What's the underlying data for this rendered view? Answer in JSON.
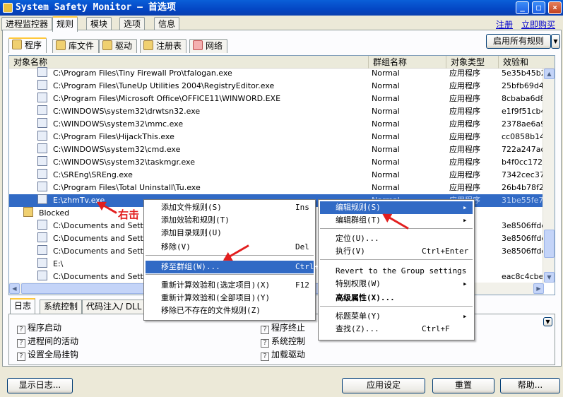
{
  "window": {
    "title": "System Safety Monitor — 首选项",
    "min": "_",
    "max": "□",
    "close": "×"
  },
  "top_tabs": [
    "进程监控器",
    "规则",
    "模块",
    "选项",
    "信息"
  ],
  "links": {
    "register": "注册",
    "buy": "立即购买"
  },
  "enable_all_label": "启用所有规则",
  "sub_tabs": [
    "程序",
    "库文件",
    "驱动",
    "注册表",
    "网络"
  ],
  "columns": [
    "对象名称",
    "群组名称",
    "对象类型",
    "效验和"
  ],
  "rows": [
    {
      "name": "C:\\Program Files\\Tiny Firewall Pro\\tfalogan.exe",
      "group": "Normal",
      "type": "应用程序",
      "checksum": "5e35b45b2"
    },
    {
      "name": "C:\\Program Files\\TuneUp Utilities 2004\\RegistryEditor.exe",
      "group": "Normal",
      "type": "应用程序",
      "checksum": "25bfb69d48"
    },
    {
      "name": "C:\\Program Files\\Microsoft Office\\OFFICE11\\WINWORD.EXE",
      "group": "Normal",
      "type": "应用程序",
      "checksum": "8cbaba6d8c"
    },
    {
      "name": "C:\\WINDOWS\\system32\\drwtsn32.exe",
      "group": "Normal",
      "type": "应用程序",
      "checksum": "e1f9f51cb44"
    },
    {
      "name": "C:\\WINDOWS\\system32\\mmc.exe",
      "group": "Normal",
      "type": "应用程序",
      "checksum": "2378ae6a95"
    },
    {
      "name": "C:\\Program Files\\HijackThis.exe",
      "group": "Normal",
      "type": "应用程序",
      "checksum": "cc0858b14f"
    },
    {
      "name": "C:\\WINDOWS\\system32\\cmd.exe",
      "group": "Normal",
      "type": "应用程序",
      "checksum": "722a247acb"
    },
    {
      "name": "C:\\WINDOWS\\system32\\taskmgr.exe",
      "group": "Normal",
      "type": "应用程序",
      "checksum": "b4f0cc1727"
    },
    {
      "name": "C:\\SREng\\SREng.exe",
      "group": "Normal",
      "type": "应用程序",
      "checksum": "7342cec375"
    },
    {
      "name": "C:\\Program Files\\Total Uninstall\\Tu.exe",
      "group": "Normal",
      "type": "应用程序",
      "checksum": "26b4b78f21"
    },
    {
      "name": "E:\\zhmTv.exe",
      "group": "Normal",
      "type": "应用程序",
      "checksum": "31be55fe72"
    },
    {
      "name": "Blocked",
      "group": "",
      "type": "",
      "checksum": ""
    },
    {
      "name": "C:\\Documents and Settings",
      "group": "",
      "type": "序",
      "checksum": "3e8506ffdde"
    },
    {
      "name": "C:\\Documents and Settings",
      "group": "",
      "type": "序",
      "checksum": "3e8506ffdde"
    },
    {
      "name": "C:\\Documents and Settings",
      "group": "",
      "type": "序",
      "checksum": "3e8506ffdde"
    },
    {
      "name": "E:\\",
      "group": "",
      "type": "目录 )",
      "checksum": ""
    },
    {
      "name": "C:\\Documents and Settings",
      "group": "",
      "type": "序",
      "checksum": "eac8c4cbe4"
    }
  ],
  "annotation": "右击",
  "menu1": [
    {
      "label": "添加文件规则(S)",
      "shortcut": "Ins"
    },
    {
      "label": "添加效验和规则(T)",
      "shortcut": ""
    },
    {
      "label": "添加目录规则(U)",
      "shortcut": ""
    },
    {
      "label": "移除(V)",
      "shortcut": "Del"
    },
    {
      "label": "移至群组(W)...",
      "shortcut": "Ctrl+C"
    },
    {
      "label": "重新计算效验和(选定项目)(X)",
      "shortcut": "F12"
    },
    {
      "label": "重新计算效验和(全部项目)(Y)",
      "shortcut": ""
    },
    {
      "label": "移除已不存在的文件规则(Z)",
      "shortcut": ""
    }
  ],
  "menu2": [
    {
      "label": "编辑规则(S)",
      "shortcut": "▸"
    },
    {
      "label": "编辑群组(T)",
      "shortcut": "▸"
    },
    {
      "label": "定位(U)...",
      "shortcut": ""
    },
    {
      "label": "执行(V)",
      "shortcut": "Ctrl+Enter"
    },
    {
      "label": "Revert to the Group settings",
      "shortcut": ""
    },
    {
      "label": "特别权限(W)",
      "shortcut": "▸"
    },
    {
      "label": "高级属性(X)...",
      "shortcut": ""
    },
    {
      "label": "标题菜单(Y)",
      "shortcut": "▸"
    },
    {
      "label": "查找(Z)...",
      "shortcut": "Ctrl+F"
    }
  ],
  "log_tabs": [
    "日志",
    "系统控制",
    "代码注入/ DLL"
  ],
  "log_options": [
    "程序启动",
    "进程间的活动",
    "设置全局挂钩",
    "程序终止",
    "系统控制",
    "加载驱动"
  ],
  "buttons": {
    "show_log": "显示日志...",
    "apply": "应用设定",
    "reset": "重置",
    "help": "帮助..."
  }
}
